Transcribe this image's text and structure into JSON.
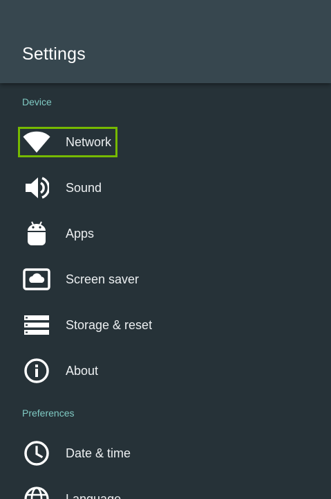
{
  "header": {
    "title": "Settings"
  },
  "sections": [
    {
      "title": "Device",
      "items": [
        {
          "label": "Network",
          "icon": "wifi-icon",
          "focused": true
        },
        {
          "label": "Sound",
          "icon": "speaker-icon"
        },
        {
          "label": "Apps",
          "icon": "android-icon"
        },
        {
          "label": "Screen saver",
          "icon": "screensaver-icon"
        },
        {
          "label": "Storage & reset",
          "icon": "storage-icon"
        },
        {
          "label": "About",
          "icon": "info-icon"
        }
      ]
    },
    {
      "title": "Preferences",
      "items": [
        {
          "label": "Date & time",
          "icon": "clock-icon"
        },
        {
          "label": "Language",
          "icon": "globe-icon"
        }
      ]
    }
  ],
  "colors": {
    "accent": "#80cbc4",
    "focus": "#76b900",
    "header": "#37474f",
    "background": "#263238"
  }
}
